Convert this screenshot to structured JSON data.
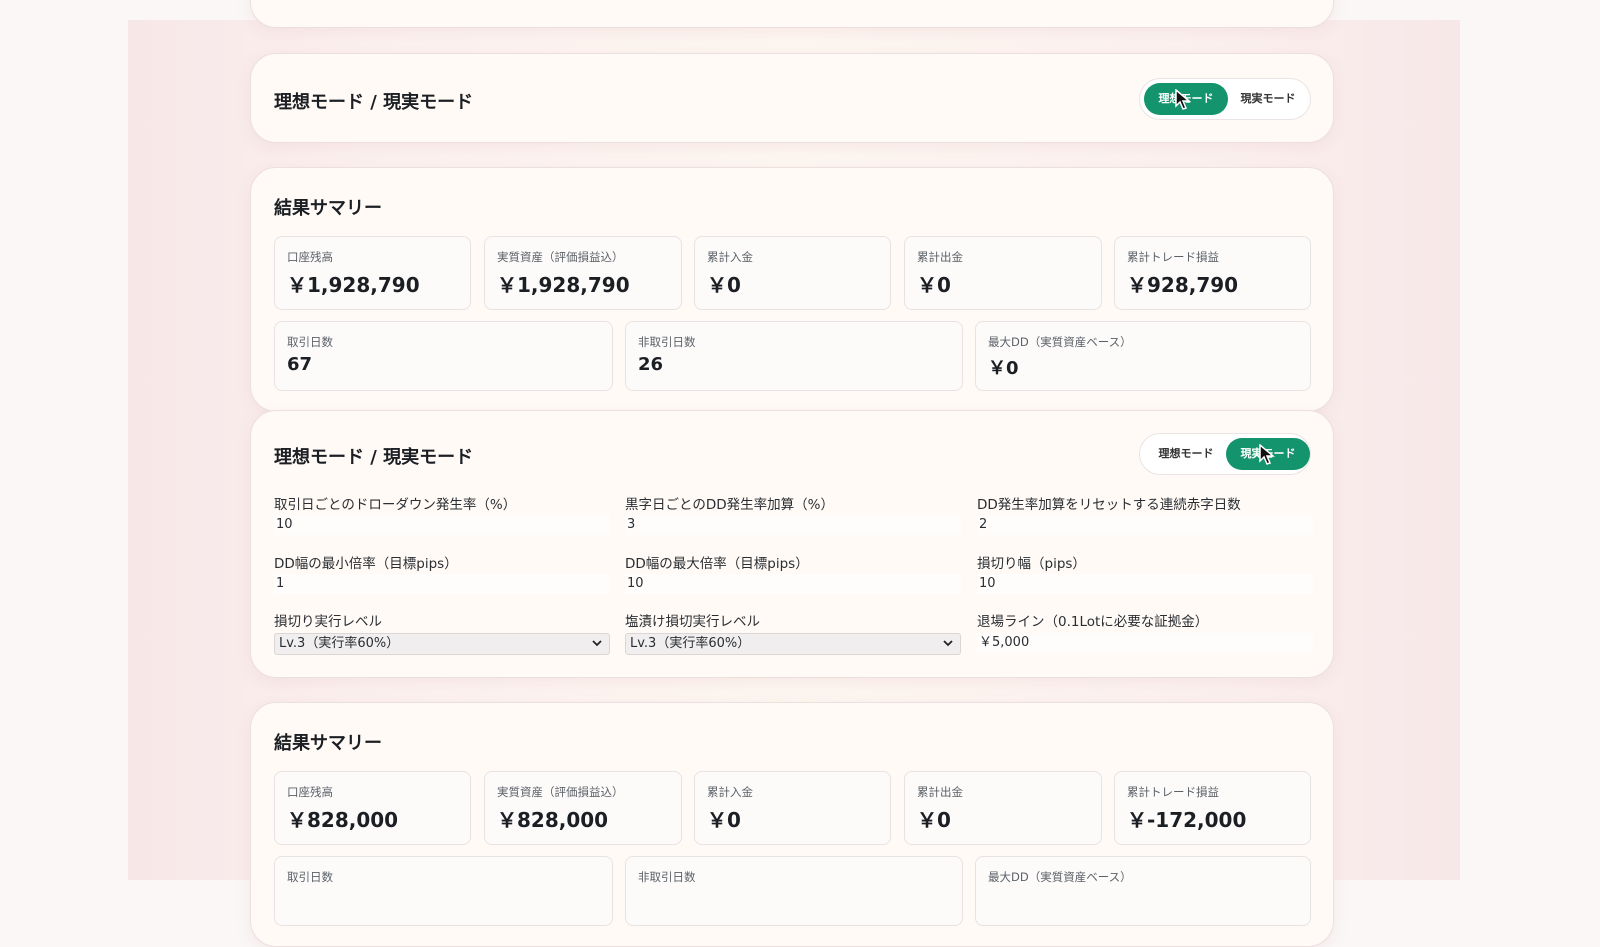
{
  "mode_label": "理想モード / 現実モード",
  "toggle_ideal": "理想モード",
  "toggle_real": "現実モード",
  "summary1": {
    "title": "結果サマリー",
    "row1": [
      {
        "label": "口座残高",
        "value": "￥1,928,790"
      },
      {
        "label": "実質資産（評価損益込）",
        "value": "￥1,928,790"
      },
      {
        "label": "累計入金",
        "value": "￥0"
      },
      {
        "label": "累計出金",
        "value": "￥0"
      },
      {
        "label": "累計トレード損益",
        "value": "￥928,790"
      }
    ],
    "row2": [
      {
        "label": "取引日数",
        "value": "67"
      },
      {
        "label": "非取引日数",
        "value": "26"
      },
      {
        "label": "最大DD（実質資産ベース）",
        "value": "￥0"
      }
    ]
  },
  "params": {
    "fields": [
      {
        "label": "取引日ごとのドローダウン発生率（%）",
        "value": "10"
      },
      {
        "label": "黒字日ごとのDD発生率加算（%）",
        "value": "3"
      },
      {
        "label": "DD発生率加算をリセットする連続赤字日数",
        "value": "2"
      },
      {
        "label": "DD幅の最小倍率（目標pips）",
        "value": "1"
      },
      {
        "label": "DD幅の最大倍率（目標pips）",
        "value": "10"
      },
      {
        "label": "損切り幅（pips）",
        "value": "10"
      },
      {
        "label": "損切り実行レベル",
        "value": "Lv.3（実行率60%）"
      },
      {
        "label": "塩漬け損切実行レベル",
        "value": "Lv.3（実行率60%）"
      },
      {
        "label": "退場ライン（0.1Lotに必要な証拠金）",
        "value": "￥5,000"
      }
    ]
  },
  "summary2": {
    "title": "結果サマリー",
    "row1": [
      {
        "label": "口座残高",
        "value": "￥828,000"
      },
      {
        "label": "実質資産（評価損益込）",
        "value": "￥828,000"
      },
      {
        "label": "累計入金",
        "value": "￥0"
      },
      {
        "label": "累計出金",
        "value": "￥0"
      },
      {
        "label": "累計トレード損益",
        "value": "￥-172,000"
      }
    ],
    "row2": [
      {
        "label": "取引日数"
      },
      {
        "label": "非取引日数"
      },
      {
        "label": "最大DD（実質資産ベース）"
      }
    ]
  },
  "colors": {
    "accent": "#13946c",
    "card_bg": "#fffaf5",
    "page_bg": "#faf7f6"
  }
}
